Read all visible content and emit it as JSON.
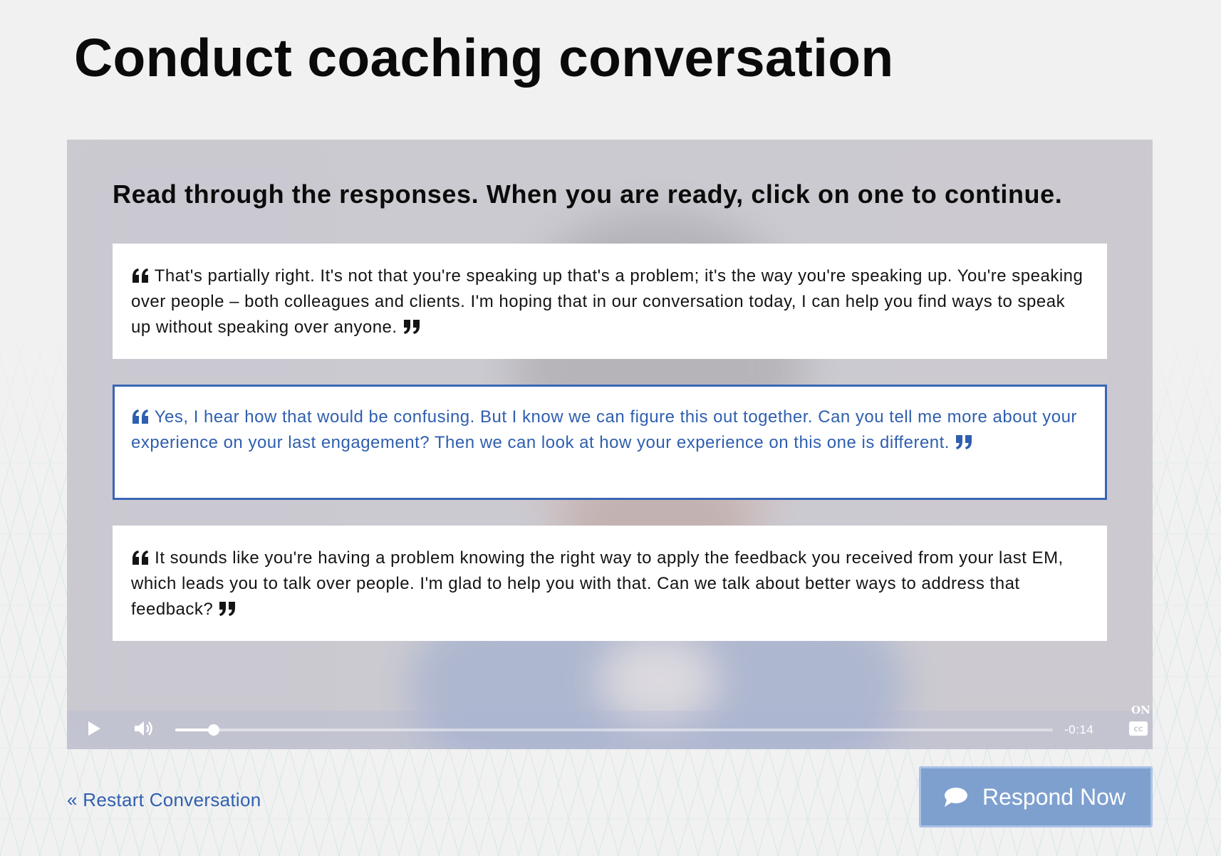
{
  "page": {
    "title": "Conduct coaching conversation"
  },
  "overlay": {
    "instructions": "Read through the responses. When you are ready, click on one to continue."
  },
  "responses": [
    {
      "text": "That's partially right. It's not that you're speaking up that's a problem; it's the way you're speaking up. You're speaking over people – both colleagues and clients. I'm hoping that in our conversation today, I can help you find ways to speak up without speaking over anyone.",
      "selected": false
    },
    {
      "text": "Yes, I hear how that would be confusing. But I know we can figure this out together. Can you tell me more about your experience on your last engagement? Then we can look at how your experience on this one is different.",
      "selected": true
    },
    {
      "text": "It sounds like you're having a problem knowing the right way to apply the feedback you received from your last EM, which leads you to talk over people. I'm glad to help you with that. Can we talk about better ways to address that feedback?",
      "selected": false
    }
  ],
  "video_controls": {
    "play_icon": "play-icon",
    "volume_icon": "volume-icon",
    "progress_fraction": 0.044,
    "time_remaining": "-0:14",
    "cc_state": "ON",
    "cc_icon": "closed-captions-icon",
    "fullscreen_icon": "fullscreen-icon"
  },
  "footer": {
    "restart_label": "« Restart Conversation",
    "respond_label": "Respond Now",
    "respond_icon": "chat-bubble-icon"
  },
  "colors": {
    "accent": "#2f5fae",
    "selected_border": "#3a66b5",
    "respond_button": "#7ea0cf",
    "background": "#f1f1f1"
  }
}
